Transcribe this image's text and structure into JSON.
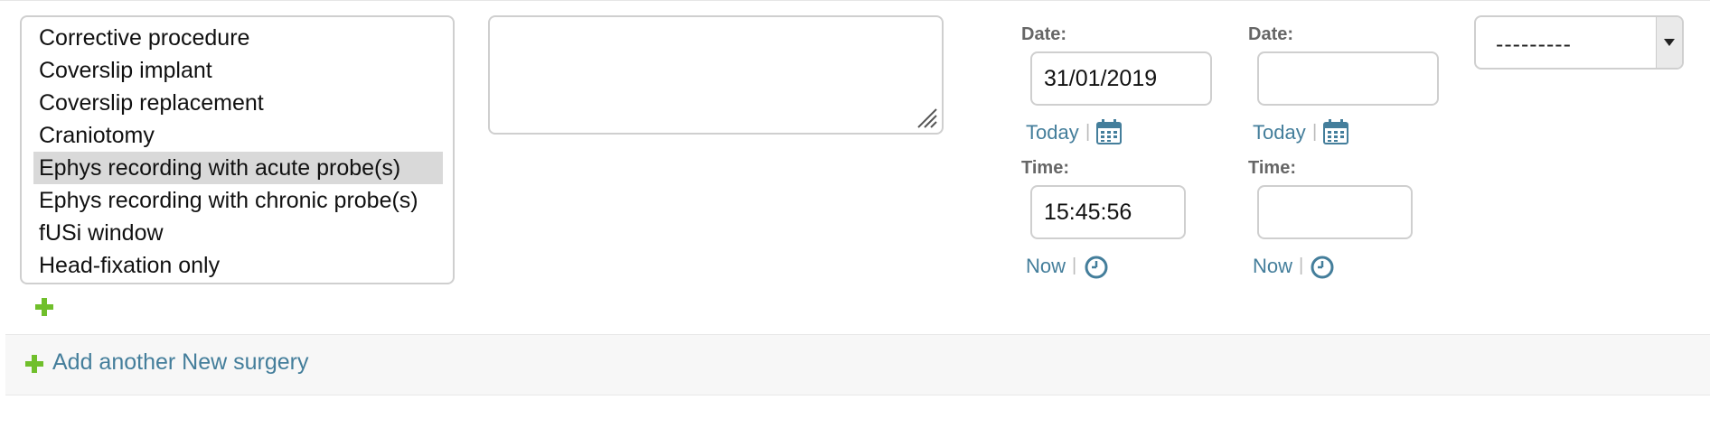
{
  "procedures": {
    "options": [
      "Corrective procedure",
      "Coverslip implant",
      "Coverslip replacement",
      "Craniotomy",
      "Ephys recording with acute probe(s)",
      "Ephys recording with chronic probe(s)",
      "fUSi window",
      "Head-fixation only"
    ],
    "selected_index": 4
  },
  "start": {
    "date_label": "Date:",
    "date_value": "31/01/2019",
    "today_link": "Today",
    "separator": "|",
    "time_label": "Time:",
    "time_value": "15:45:56",
    "now_link": "Now"
  },
  "end": {
    "date_label": "Date:",
    "date_value": "",
    "today_link": "Today",
    "separator": "|",
    "time_label": "Time:",
    "time_value": "",
    "now_link": "Now"
  },
  "dropdown": {
    "selected": "---------"
  },
  "footer": {
    "add_link": "Add another New surgery"
  },
  "colors": {
    "link": "#447e9b",
    "add_green": "#70bf2b",
    "selected_row": "#d9d9d9"
  },
  "icons": {
    "add": "plus-icon",
    "calendar": "calendar-icon",
    "clock": "clock-icon",
    "resize": "resize-grip-icon"
  }
}
